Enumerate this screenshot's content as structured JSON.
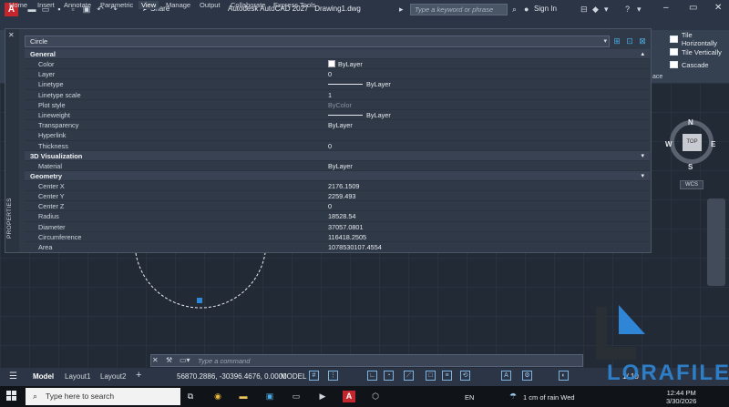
{
  "window": {
    "title": "Autodesk AutoCAD 2027",
    "document": "Drawing1.dwg",
    "share_label": "Share",
    "search_placeholder": "Type a keyword or phrase",
    "sign_in": "Sign In"
  },
  "ribbon": {
    "tabs": [
      "Home",
      "Insert",
      "Annotate",
      "Parametric",
      "View",
      "Manage",
      "Output",
      "Collaborate",
      "Express Tools"
    ],
    "active_tab": "View",
    "right_panel": [
      "Tile Horizontally",
      "Tile Vertically",
      "Cascade"
    ],
    "interface_label": "ace"
  },
  "properties": {
    "palette_label": "PROPERTIES",
    "selection": "Circle",
    "sections": [
      {
        "title": "General",
        "rows": [
          {
            "key": "Color",
            "value": "ByLayer",
            "kind": "swatch"
          },
          {
            "key": "Layer",
            "value": "0"
          },
          {
            "key": "Linetype",
            "value": "ByLayer",
            "kind": "line"
          },
          {
            "key": "Linetype scale",
            "value": "1"
          },
          {
            "key": "Plot style",
            "value": "ByColor",
            "kind": "dim"
          },
          {
            "key": "Lineweight",
            "value": "ByLayer",
            "kind": "line"
          },
          {
            "key": "Transparency",
            "value": "ByLayer"
          },
          {
            "key": "Hyperlink",
            "value": ""
          },
          {
            "key": "Thickness",
            "value": "0"
          }
        ]
      },
      {
        "title": "3D Visualization",
        "rows": [
          {
            "key": "Material",
            "value": "ByLayer"
          }
        ]
      },
      {
        "title": "Geometry",
        "rows": [
          {
            "key": "Center X",
            "value": "2176.1509"
          },
          {
            "key": "Center Y",
            "value": "2259.493"
          },
          {
            "key": "Center Z",
            "value": "0"
          },
          {
            "key": "Radius",
            "value": "18528.54"
          },
          {
            "key": "Diameter",
            "value": "37057.0801"
          },
          {
            "key": "Circumference",
            "value": "116418.2505"
          },
          {
            "key": "Area",
            "value": "1078530107.4554"
          }
        ]
      }
    ]
  },
  "viewcube": {
    "north": "N",
    "south": "S",
    "east": "E",
    "west": "W",
    "face": "TOP",
    "ucs": "WCS"
  },
  "command": {
    "placeholder": "Type a command"
  },
  "status": {
    "menu_icon": "hamburger-menu-icon",
    "layout_tabs": [
      "Model",
      "Layout1",
      "Layout2"
    ],
    "active_layout": "Model",
    "add_tab": "+",
    "coordinates": "56870.2886, -30396.4676, 0.0000",
    "space": "MODEL",
    "zoom": "1/ 10"
  },
  "watermark": {
    "text": "LORAFILE"
  },
  "taskbar": {
    "search_placeholder": "Type here to search",
    "language": "EN",
    "weather": "1 cm of rain Wed",
    "time": "12:44 PM",
    "date": "3/30/2026"
  },
  "colors": {
    "accent": "#2f86d6",
    "grip": "#2f86d6",
    "app_red": "#c4262e"
  }
}
